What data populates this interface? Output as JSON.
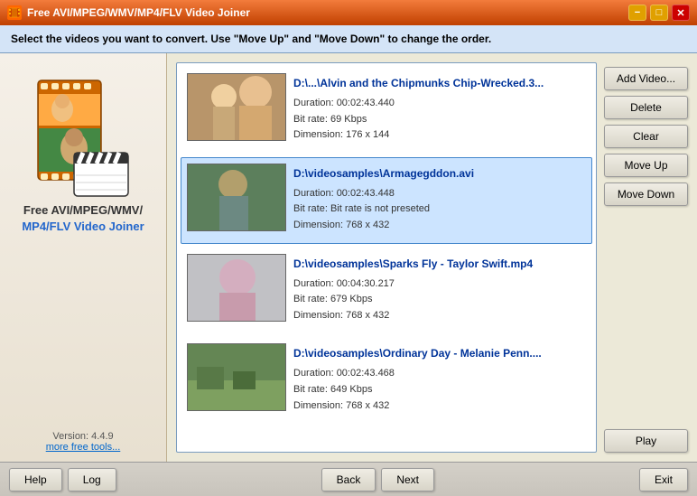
{
  "titlebar": {
    "icon": "🎬",
    "title": "Free AVI/MPEG/WMV/MP4/FLV Video Joiner",
    "min_btn": "−",
    "max_btn": "□",
    "close_btn": "✕"
  },
  "instruction": {
    "text": "Select the videos you want to convert. Use \"Move Up\" and \"Move Down\" to change the order."
  },
  "sidebar": {
    "app_name_line1": "Free AVI/MPEG/WMV/",
    "app_name_line2": "MP4/FLV Video Joiner",
    "version": "Version: 4.4.9",
    "more_tools": "more free tools..."
  },
  "videos": [
    {
      "filename": "D:\\...\\Alvin and the Chipmunks Chip-Wrecked.3...",
      "duration": "Duration: 00:02:43.440",
      "bitrate": "Bit rate: 69 Kbps",
      "dimension": "Dimension: 176 x 144",
      "thumb_class": "thumb-1",
      "selected": false
    },
    {
      "filename": "D:\\videosamples\\Armagegddon.avi",
      "duration": "Duration: 00:02:43.448",
      "bitrate": "Bit rate: Bit rate is not preseted",
      "dimension": "Dimension: 768 x 432",
      "thumb_class": "thumb-2",
      "selected": true
    },
    {
      "filename": "D:\\videosamples\\Sparks Fly - Taylor Swift.mp4",
      "duration": "Duration: 00:04:30.217",
      "bitrate": "Bit rate: 679 Kbps",
      "dimension": "Dimension: 768 x 432",
      "thumb_class": "thumb-3",
      "selected": false
    },
    {
      "filename": "D:\\videosamples\\Ordinary Day - Melanie Penn....",
      "duration": "Duration: 00:02:43.468",
      "bitrate": "Bit rate: 649 Kbps",
      "dimension": "Dimension: 768 x 432",
      "thumb_class": "thumb-4",
      "selected": false
    }
  ],
  "buttons": {
    "add_video": "Add Video...",
    "delete": "Delete",
    "clear": "Clear",
    "move_up": "Move Up",
    "move_down": "Move Down",
    "play": "Play"
  },
  "bottom_buttons": {
    "help": "Help",
    "log": "Log",
    "back": "Back",
    "next": "Next",
    "exit": "Exit"
  }
}
